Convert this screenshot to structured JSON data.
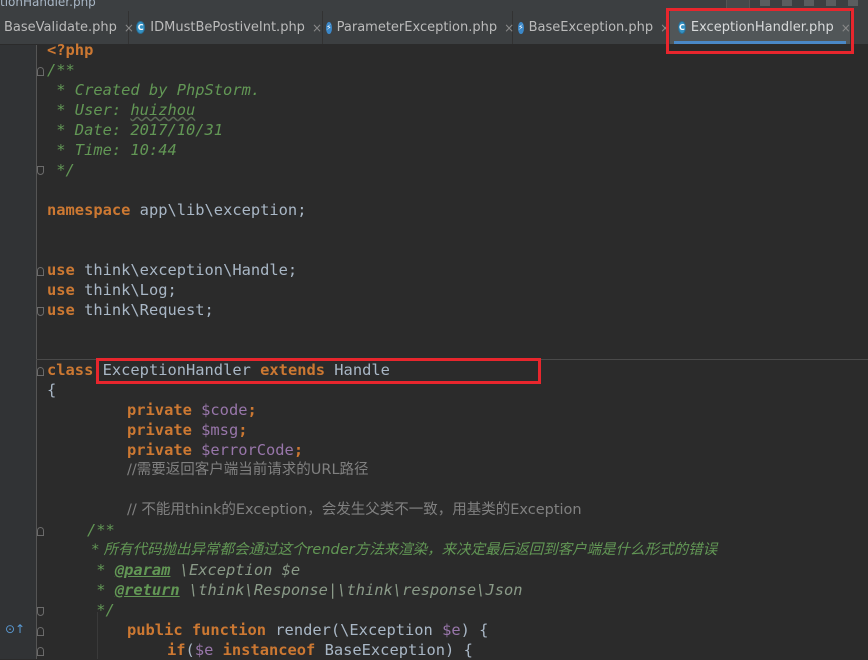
{
  "window": {
    "clipped_title": "tionHandler.php"
  },
  "tabs": [
    {
      "label": "BaseValidate.php",
      "icon": "php-file-icon",
      "active": false
    },
    {
      "label": "IDMustBePostiveInt.php",
      "icon": "php-class-icon",
      "active": false
    },
    {
      "label": "ParameterException.php",
      "icon": "php-file-icon",
      "active": false
    },
    {
      "label": "BaseException.php",
      "icon": "php-file-icon",
      "active": false
    },
    {
      "label": "ExceptionHandler.php",
      "icon": "php-class-icon",
      "active": true
    }
  ],
  "close_glyph": "×",
  "icon_letters": {
    "class": "C",
    "file": "⚡"
  },
  "colors": {
    "highlight_box": "#e8262d",
    "keyword": "#cc7832",
    "doc_comment": "#629755",
    "variable": "#9876aa",
    "comment": "#808080",
    "text": "#a9b7c6"
  },
  "code": {
    "open_tag": "<?php",
    "doc1": "/**",
    "doc2": " * Created by PhpStorm.",
    "doc3_pre": " * User: ",
    "doc3_user": "huizhou",
    "doc4": " * Date: 2017/10/31",
    "doc5": " * Time: 10:44",
    "doc6": " */",
    "ns_kw": "namespace",
    "ns_val": " app\\lib\\exception;",
    "use_kw": "use",
    "use1": " think\\exception\\Handle;",
    "use2": " think\\Log;",
    "use3": " think\\Request;",
    "class_kw": "class",
    "class_name": " ExceptionHandler ",
    "extends_kw": "extends",
    "parent": " Handle",
    "brace_open": "{",
    "private_kw": "private",
    "var1": " $code",
    "var2": " $msg",
    "var3": " $errorCode",
    "semicolon": ";",
    "comment1": "//需要返回客户端当前请求的URL路径",
    "comment2": "// 不能用think的Exception，会发生父类不一致，用基类的Exception",
    "doc7": "/**",
    "doc8_pre": " * 所有代码抛出异常都会通过这个",
    "doc8_render": "render",
    "doc8_post": "方法来渲染，来决定最后返回到客户端是什么形式的错误",
    "doc9_star": " * ",
    "param_tag": "@param",
    "doc9_rest": " \\Exception $e",
    "doc10_star": " * ",
    "return_tag": "@return",
    "doc10_rest": " \\think\\Response|\\think\\response\\Json",
    "doc11": " */",
    "public_kw": "public",
    "function_kw": " function",
    "fn_sig": " render(\\Exception ",
    "fn_var": "$e",
    "fn_end": ") {",
    "if_kw": "if",
    "if_open": "(",
    "if_var": "$e",
    "instanceof_kw": " instanceof",
    "if_rest": " BaseException) {"
  }
}
